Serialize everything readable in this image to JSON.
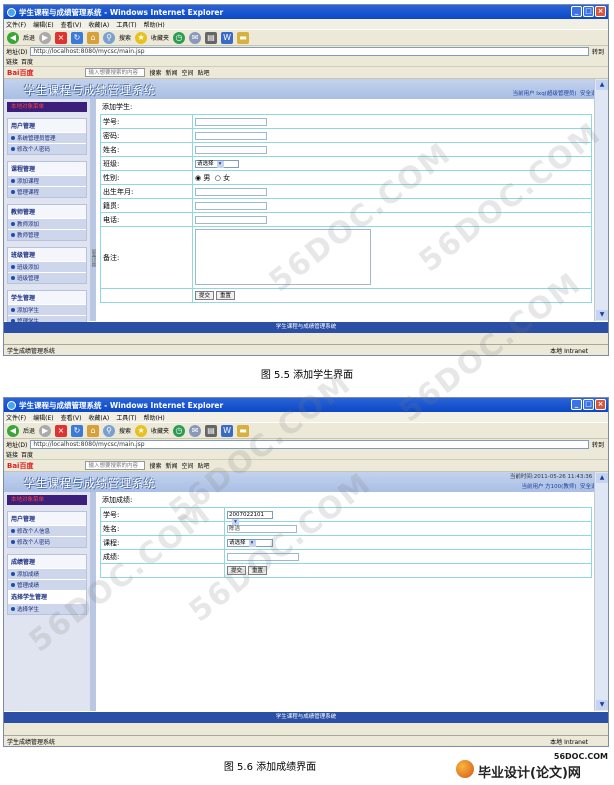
{
  "browser": {
    "window_title": "学生课程与成绩管理系统 - Windows Internet Explorer",
    "menu": [
      "文件(F)",
      "编辑(E)",
      "查看(V)",
      "收藏(A)",
      "工具(T)",
      "帮助(H)"
    ],
    "toolbar": [
      "后退",
      "搜索",
      "收藏夹"
    ],
    "address_label": "地址(D)",
    "address_url": "http://localhost:8080/mycsc/main.jsp",
    "go_label": "转到",
    "favorites_label": "链接",
    "baidu_label": "百度",
    "baidu_logo": "Bai百度",
    "baidu_placeholder": "输入想要搜索的内容",
    "baidu_buttons": [
      "搜索",
      "新闻",
      "空间",
      "贴吧"
    ],
    "status_left": "学生成绩管理系统",
    "status_zone": "本地 Intranet"
  },
  "app": {
    "title": "学生课程与成绩管理系统",
    "footer": "学生课程与成绩管理系统",
    "logout": "安全退出",
    "time_line": "当前时间:2011-05-26 11:43:36 PM"
  },
  "screen1": {
    "user_line": "当前用户 Ixq(超级管理员)",
    "sidebar_top": "本地对象菜单",
    "groups": [
      {
        "head": "用户管理",
        "items": [
          "系统管理员管理",
          "修改个人密码"
        ]
      },
      {
        "head": "课程管理",
        "items": [
          "添加课程",
          "管理课程"
        ]
      },
      {
        "head": "教师管理",
        "items": [
          "教师添加",
          "教师管理"
        ]
      },
      {
        "head": "班级管理",
        "items": [
          "班级添加",
          "班级管理"
        ]
      },
      {
        "head": "学生管理",
        "items": [
          "添加学生",
          "管理学生"
        ]
      }
    ],
    "splitter_label": "屏幕切换",
    "form_title": "添加学生:",
    "fields": {
      "id": "学号:",
      "password": "密码:",
      "name": "姓名:",
      "class": "班级:",
      "class_select": "请选择",
      "gender": "性别:",
      "male": "男",
      "female": "女",
      "birth": "出生年月:",
      "origin": "籍贯:",
      "phone": "电话:",
      "remark": "备注:"
    },
    "submit": "提交",
    "reset": "重置"
  },
  "screen2": {
    "user_line": "当前用户 方100(教师)",
    "sidebar_top": "本地对象菜单",
    "groups": [
      {
        "head": "用户管理",
        "items": [
          "修改个人信息",
          "修改个人密码"
        ]
      },
      {
        "head": "成绩管理",
        "items": [
          "添加成绩",
          "管理成绩"
        ]
      },
      {
        "head": "选择学生管理",
        "items": [
          "选择学生"
        ]
      }
    ],
    "form_title": "添加成绩:",
    "fields": {
      "id": "学号:",
      "id_value": "2007022101",
      "name": "姓名:",
      "name_value": "陈洁",
      "course": "课程:",
      "course_select": "请选择",
      "score": "成绩:"
    },
    "submit": "提交",
    "reset": "重置"
  },
  "captions": {
    "fig1": "图 5.5    添加学生界面",
    "fig2": "图 5.6    添加成绩界面"
  },
  "watermark": "56DOC.COM",
  "brand": {
    "site": "56DOC.COM",
    "name": "毕业设计(论文)网"
  }
}
